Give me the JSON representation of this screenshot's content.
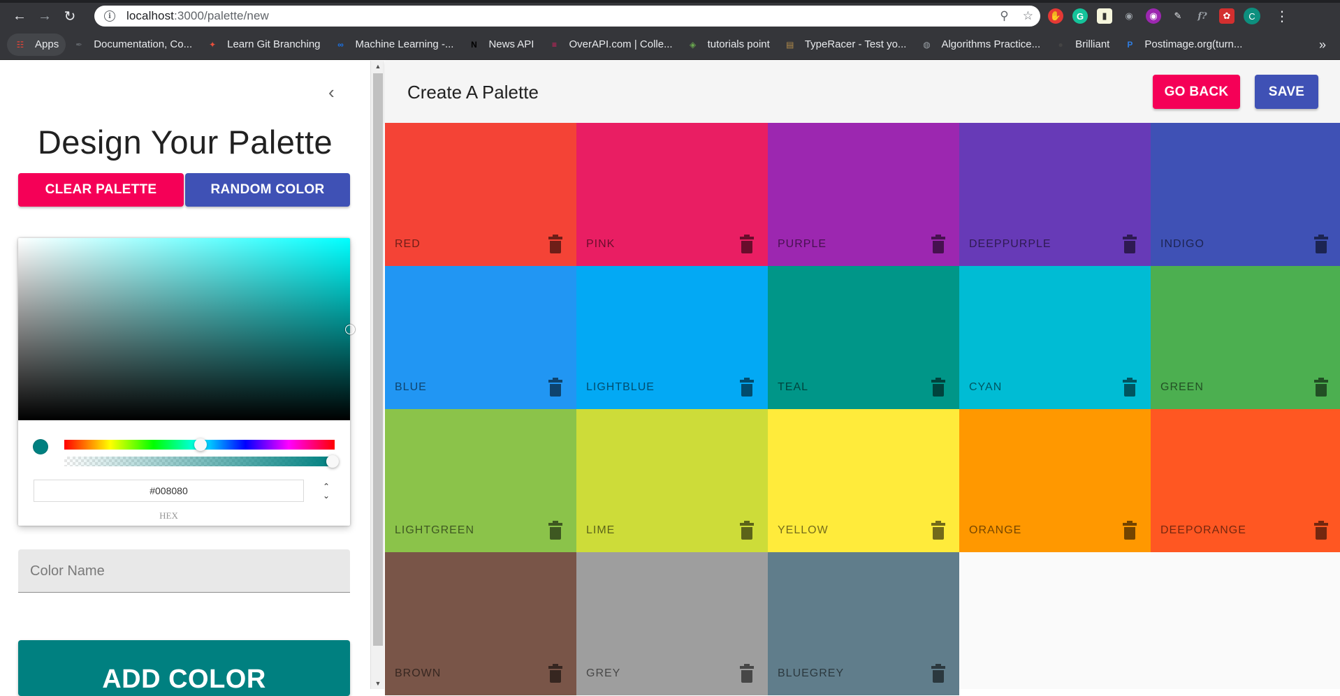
{
  "browser": {
    "url_host": "localhost",
    "url_path": ":3000/palette/new",
    "profile_initial": "C",
    "bookmarks": [
      {
        "label": "Apps",
        "icon": "apps-grid-icon",
        "color": "#ea4335"
      },
      {
        "label": "Documentation, Co...",
        "icon": "documentation-icon",
        "color": "#5f6368"
      },
      {
        "label": "Learn Git Branching",
        "icon": "git-icon",
        "color": "#e94f3c"
      },
      {
        "label": "Machine Learning -...",
        "icon": "infinity-icon",
        "color": "#1a73e8"
      },
      {
        "label": "News API",
        "icon": "n-logo-icon",
        "color": "#000000"
      },
      {
        "label": "OverAPI.com | Colle...",
        "icon": "overapi-icon",
        "color": "#e91e63"
      },
      {
        "label": "tutorials point",
        "icon": "tutorialspoint-icon",
        "color": "#6aa84f"
      },
      {
        "label": "TypeRacer - Test yo...",
        "icon": "typeracer-icon",
        "color": "#b28b4a"
      },
      {
        "label": "Algorithms Practice...",
        "icon": "globe-icon",
        "color": "#9aa0a6"
      },
      {
        "label": "Brilliant",
        "icon": "brilliant-icon",
        "color": "#444444"
      },
      {
        "label": "Postimage.org(turn...",
        "icon": "postimage-icon",
        "color": "#2f7de1"
      }
    ]
  },
  "drawer": {
    "title": "Design Your Palette",
    "clear_label": "Clear Palette",
    "random_label": "Random Color",
    "hex_value": "#008080",
    "hex_label": "HEX",
    "color_name_placeholder": "Color Name",
    "add_color_label": "ADD COLOR",
    "current_color": "#008080"
  },
  "appbar": {
    "title": "Create A Palette",
    "go_back_label": "GO BACK",
    "save_label": "SAVE"
  },
  "colors": [
    {
      "name": "red",
      "hex": "#F44336"
    },
    {
      "name": "pink",
      "hex": "#E91E63"
    },
    {
      "name": "purple",
      "hex": "#9C27B0"
    },
    {
      "name": "deeppurple",
      "hex": "#673AB7"
    },
    {
      "name": "indigo",
      "hex": "#3F51B5"
    },
    {
      "name": "blue",
      "hex": "#2196F3"
    },
    {
      "name": "lightblue",
      "hex": "#03A9F4"
    },
    {
      "name": "teal",
      "hex": "#009688"
    },
    {
      "name": "cyan",
      "hex": "#00BCD4"
    },
    {
      "name": "green",
      "hex": "#4CAF50"
    },
    {
      "name": "lightgreen",
      "hex": "#8BC34A"
    },
    {
      "name": "lime",
      "hex": "#CDDC39"
    },
    {
      "name": "yellow",
      "hex": "#FFEB3B"
    },
    {
      "name": "orange",
      "hex": "#FF9800"
    },
    {
      "name": "deeporange",
      "hex": "#FF5722"
    },
    {
      "name": "brown",
      "hex": "#795548"
    },
    {
      "name": "grey",
      "hex": "#9E9E9E"
    },
    {
      "name": "bluegrey",
      "hex": "#607D8B"
    }
  ]
}
